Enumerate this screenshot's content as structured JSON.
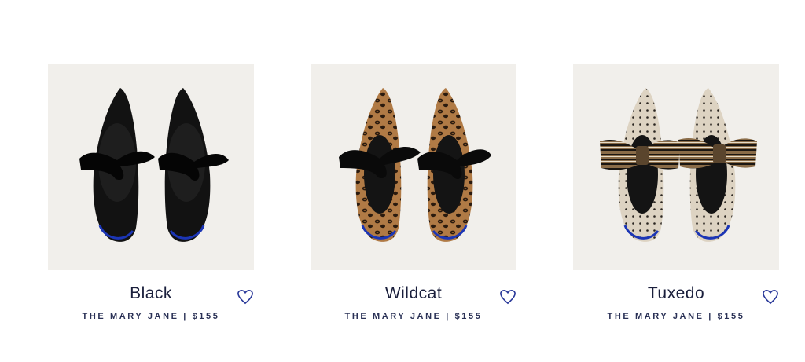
{
  "products": [
    {
      "name": "Black",
      "style": "THE MARY JANE",
      "separator": "|",
      "price": "$155",
      "swatch": "black",
      "wishlist_icon": "heart-outline-icon"
    },
    {
      "name": "Wildcat",
      "style": "THE MARY JANE",
      "separator": "|",
      "price": "$155",
      "swatch": "leopard",
      "wishlist_icon": "heart-outline-icon"
    },
    {
      "name": "Tuxedo",
      "style": "THE MARY JANE",
      "separator": "|",
      "price": "$155",
      "swatch": "tuxedo",
      "wishlist_icon": "heart-outline-icon"
    }
  ],
  "colors": {
    "text": "#1a1f3c",
    "heart": "#2b3a9a",
    "image_bg": "#f1efeb",
    "insole_accent": "#1b35b5"
  }
}
